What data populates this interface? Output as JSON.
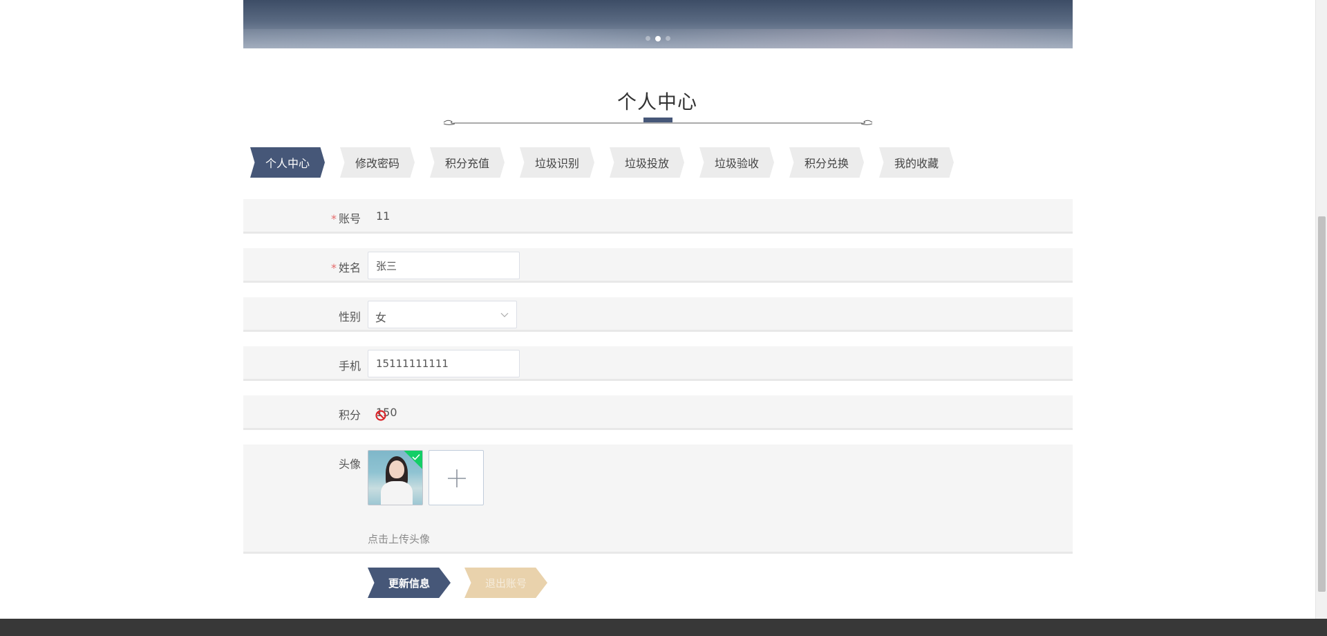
{
  "banner": {
    "slides": 3,
    "active_slide": 2
  },
  "page_title": "个人中心",
  "tabs": [
    {
      "label": "个人中心",
      "active": true
    },
    {
      "label": "修改密码",
      "active": false
    },
    {
      "label": "积分充值",
      "active": false
    },
    {
      "label": "垃圾识别",
      "active": false
    },
    {
      "label": "垃圾投放",
      "active": false
    },
    {
      "label": "垃圾验收",
      "active": false
    },
    {
      "label": "积分兑换",
      "active": false
    },
    {
      "label": "我的收藏",
      "active": false
    }
  ],
  "form": {
    "account": {
      "label": "账号",
      "required_mark": "*",
      "value": "11"
    },
    "name": {
      "label": "姓名",
      "required_mark": "*",
      "value": "张三"
    },
    "gender": {
      "label": "性别",
      "value": "女"
    },
    "phone": {
      "label": "手机",
      "value": "15111111111"
    },
    "points": {
      "label": "积分",
      "value": "150",
      "cursor_icon": "not-allowed-icon"
    },
    "avatar": {
      "label": "头像",
      "hint": "点击上传头像",
      "uploaded": true
    }
  },
  "buttons": {
    "update": "更新信息",
    "logout": "退出账号"
  },
  "colors": {
    "primary": "#465778",
    "secondary": "#e9d2ac",
    "required": "#e56b6b",
    "success": "#13ce66",
    "footer": "#383838"
  }
}
